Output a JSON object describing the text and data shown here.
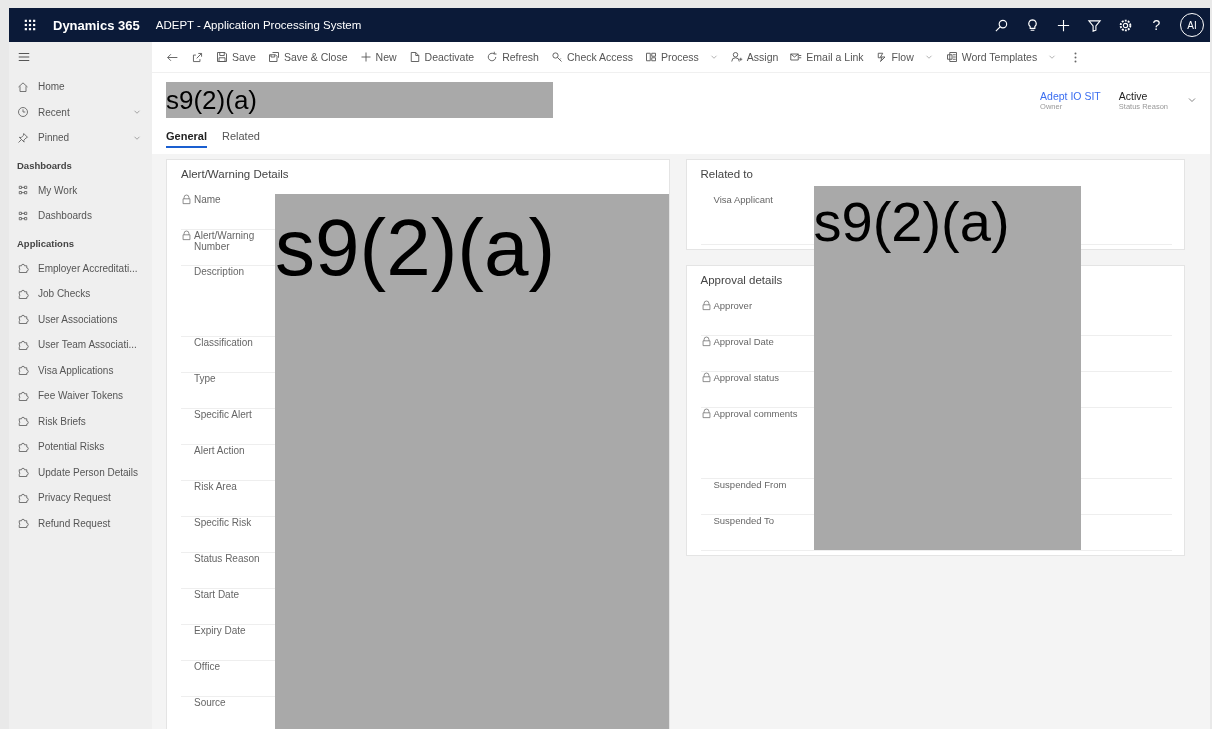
{
  "app_bar": {
    "app_name": "Dynamics 365",
    "title": "ADEPT - Application Processing System",
    "help": "?",
    "avatar": "AI"
  },
  "command_bar": [
    {
      "kind": "icon"
    },
    {
      "kind": "icon"
    },
    {
      "kind": "button",
      "label": "Save",
      "dropdown": false
    },
    {
      "kind": "button",
      "label": "Save & Close",
      "dropdown": false
    },
    {
      "kind": "button",
      "label": "New",
      "dropdown": false
    },
    {
      "kind": "button",
      "label": "Deactivate",
      "dropdown": false
    },
    {
      "kind": "button",
      "label": "Refresh",
      "dropdown": false
    },
    {
      "kind": "button",
      "label": "Check Access",
      "dropdown": false
    },
    {
      "kind": "button",
      "label": "Process",
      "dropdown": true
    },
    {
      "kind": "button",
      "label": "Assign",
      "dropdown": false
    },
    {
      "kind": "button",
      "label": "Email a Link",
      "dropdown": false
    },
    {
      "kind": "button",
      "label": "Flow",
      "dropdown": true
    },
    {
      "kind": "button",
      "label": "Word Templates",
      "dropdown": true
    },
    {
      "kind": "more"
    }
  ],
  "sidebar": {
    "items": [
      {
        "label": "Home",
        "expandable": false
      },
      {
        "label": "Recent",
        "expandable": true
      },
      {
        "label": "Pinned",
        "expandable": true
      }
    ],
    "groups": [
      {
        "title": "Dashboards",
        "items": [
          "My Work",
          "Dashboards"
        ]
      },
      {
        "title": "Applications",
        "items": [
          "Employer Accreditati...",
          "Job Checks",
          "User Associations",
          "User Team Associati...",
          "Visa Applications",
          "Fee Waiver Tokens",
          "Risk Briefs",
          "Potential Risks",
          "Update Person Details",
          "Privacy Request",
          "Refund Request"
        ]
      }
    ]
  },
  "record": {
    "title_redaction": "s9(2)(a)",
    "owner": "Adept IO SIT",
    "owner_label": "Owner",
    "status": "Active",
    "status_label": "Status Reason"
  },
  "tabs": [
    {
      "label": "General",
      "selected": true
    },
    {
      "label": "Related",
      "selected": false
    }
  ],
  "left_column": {
    "redaction": "s9(2)(a)",
    "sections": [
      {
        "title": "Alert/Warning Details",
        "fields": [
          {
            "label": "Name",
            "locked": true,
            "kind": "single"
          },
          {
            "label": "Alert/Warning Number",
            "locked": true,
            "kind": "single"
          },
          {
            "label": "Description",
            "locked": false,
            "kind": "multiline"
          },
          {
            "label": "Classification",
            "locked": false,
            "kind": "single"
          },
          {
            "label": "Type",
            "locked": false,
            "kind": "single"
          },
          {
            "label": "Specific Alert",
            "locked": false,
            "kind": "single"
          },
          {
            "label": "Alert Action",
            "locked": false,
            "kind": "single"
          },
          {
            "label": "Risk Area",
            "locked": false,
            "kind": "single"
          },
          {
            "label": "Specific Risk",
            "locked": false,
            "kind": "single"
          },
          {
            "label": "Status Reason",
            "locked": false,
            "kind": "single"
          },
          {
            "label": "Start Date",
            "locked": false,
            "kind": "single"
          },
          {
            "label": "Expiry Date",
            "locked": false,
            "kind": "single"
          },
          {
            "label": "Office",
            "locked": false,
            "kind": "single"
          },
          {
            "label": "Source",
            "locked": false,
            "kind": "single"
          }
        ]
      }
    ]
  },
  "right_column": {
    "redaction": "s9(2)(a)",
    "sections": [
      {
        "title": "Related to",
        "fields": [
          {
            "label": "Visa Applicant",
            "locked": false,
            "kind": "lookup"
          }
        ]
      },
      {
        "title": "Approval details",
        "fields": [
          {
            "label": "Approver",
            "locked": true,
            "kind": "single"
          },
          {
            "label": "Approval Date",
            "locked": true,
            "kind": "single"
          },
          {
            "label": "Approval status",
            "locked": true,
            "kind": "single"
          },
          {
            "label": "Approval comments",
            "locked": true,
            "kind": "multiline"
          },
          {
            "label": "Suspended From",
            "locked": false,
            "kind": "single"
          },
          {
            "label": "Suspended To",
            "locked": false,
            "kind": "single"
          }
        ]
      }
    ]
  }
}
